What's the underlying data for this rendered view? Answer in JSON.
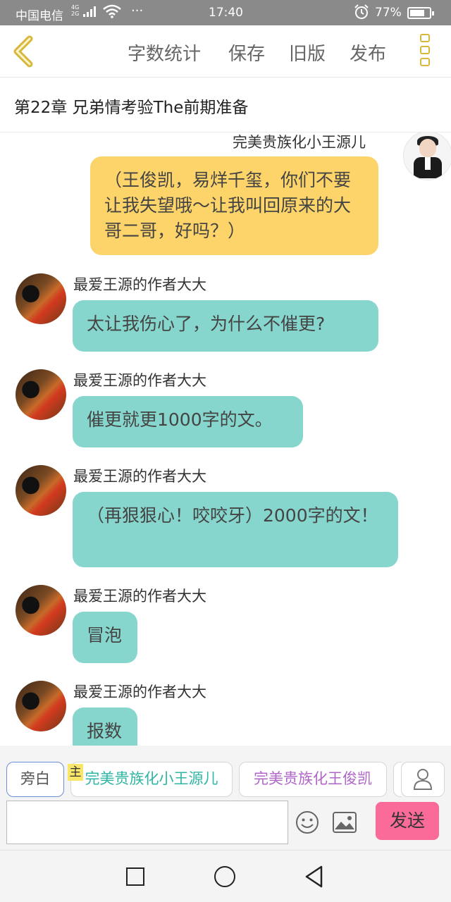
{
  "status_bar": {
    "carrier": "中国电信",
    "network_top": "4G",
    "network_bottom": "2G",
    "overflow": "···",
    "time": "17:40",
    "battery": "77%",
    "battery_level": 0.77
  },
  "toolbar": {
    "back_icon": "chevron-left-icon",
    "word_count": "字数统计",
    "save": "保存",
    "old_version": "旧版",
    "publish": "发布",
    "more_icon": "more-vertical-icon",
    "accent_color": "#d8b83a"
  },
  "chapter": {
    "title": "第22章  兄弟情考验The前期准备"
  },
  "messages": [
    {
      "side": "right",
      "name": "完美贵族化小王源儿",
      "text": "（王俊凯，易烊千玺，你们不要让我失望哦～让我叫回原来的大哥二哥，好吗？）",
      "color": "#fdd46a"
    },
    {
      "side": "left",
      "name": "最爱王源的作者大大",
      "text": "太让我伤心了，为什么不催更?",
      "color": "#86d6cd"
    },
    {
      "side": "left",
      "name": "最爱王源的作者大大",
      "text": "催更就更1000字的文。",
      "color": "#86d6cd"
    },
    {
      "side": "left",
      "name": "最爱王源的作者大大",
      "text": "（再狠狠心！咬咬牙）2000字的文！",
      "color": "#86d6cd"
    },
    {
      "side": "left",
      "name": "最爱王源的作者大大",
      "text": "冒泡",
      "color": "#86d6cd"
    },
    {
      "side": "left",
      "name": "最爱王源的作者大大",
      "text": "报数",
      "color": "#86d6cd"
    }
  ],
  "input_bar": {
    "narration": "旁白",
    "main_tag": "主",
    "role1": "完美贵族化小王源儿",
    "role2": "完美贵族化王俊凯",
    "person_icon": "person-icon",
    "text_value": "",
    "emoji_icon": "emoji-icon",
    "image_icon": "image-icon",
    "send": "发送",
    "send_color": "#fb6b9a"
  },
  "nav_bar": {
    "recent_icon": "square-icon",
    "home_icon": "circle-icon",
    "back_icon": "triangle-back-icon"
  }
}
